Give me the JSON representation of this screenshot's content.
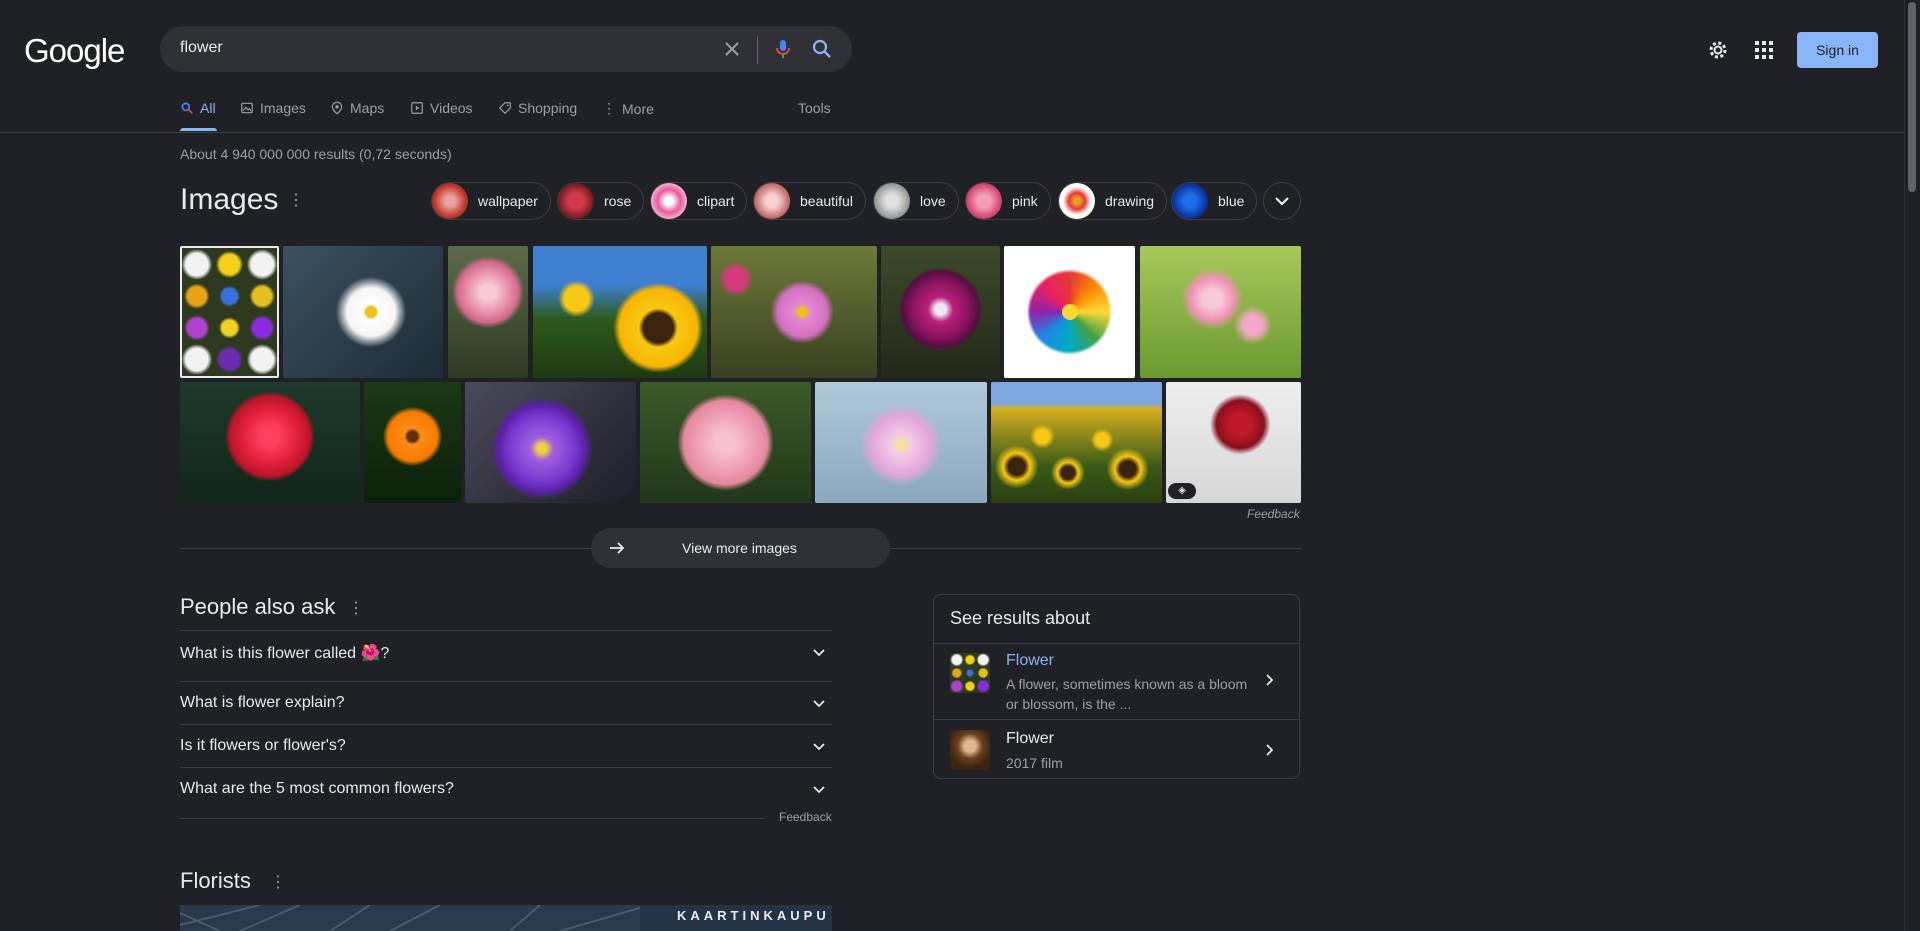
{
  "header": {
    "logo": "Google",
    "search_value": "flower",
    "sign_in": "Sign in"
  },
  "tabs": [
    {
      "label": "All",
      "icon": "search-icon"
    },
    {
      "label": "Images",
      "icon": "image-icon"
    },
    {
      "label": "Maps",
      "icon": "map-pin-icon"
    },
    {
      "label": "Videos",
      "icon": "play-icon"
    },
    {
      "label": "Shopping",
      "icon": "tag-icon"
    },
    {
      "label": "More",
      "icon": "vertical-dots-icon"
    }
  ],
  "tools_label": "Tools",
  "result_stats": "About 4 940 000 000 results (0,72 seconds)",
  "images": {
    "title": "Images",
    "chips": [
      "wallpaper",
      "rose",
      "clipart",
      "beautiful",
      "love",
      "pink",
      "drawing",
      "blue"
    ],
    "feedback": "Feedback",
    "view_more": "View more images"
  },
  "people_also_ask": {
    "title": "People also ask",
    "questions": [
      {
        "pre": "What is this flower called ",
        "emoji": "🌺",
        "post": "?"
      },
      {
        "pre": "What is flower explain?",
        "emoji": "",
        "post": ""
      },
      {
        "pre": "Is it flowers or flower's?",
        "emoji": "",
        "post": ""
      },
      {
        "pre": "What are the 5 most common flowers?",
        "emoji": "",
        "post": ""
      }
    ],
    "feedback": "Feedback"
  },
  "see_results_about": {
    "title": "See results about",
    "entities": [
      {
        "name": "Flower",
        "description": "A flower, sometimes known as a bloom or blossom, is the ...",
        "name_color": "#8ab4f8"
      },
      {
        "name": "Flower",
        "description": "2017 film",
        "name_color": "#e8eaed"
      }
    ]
  },
  "florists": {
    "title": "Florists",
    "map_label": "KAARTINKAUPU"
  },
  "colors": {
    "background": "#202124",
    "accent": "#8ab4f8",
    "text": "#e8eaed",
    "muted": "#9aa0a6"
  }
}
